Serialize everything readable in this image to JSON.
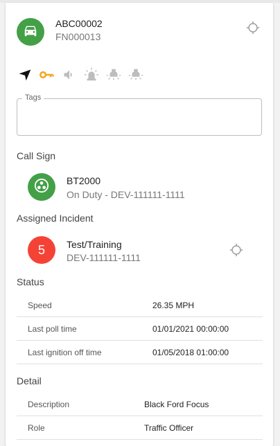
{
  "vehicle": {
    "title": "ABC00002",
    "subtitle": "FN000013",
    "avatar_icon": "car-icon",
    "avatar_color": "#43a047"
  },
  "status_icons": [
    {
      "name": "navigation-arrow-icon",
      "color": "#111111"
    },
    {
      "name": "key-icon",
      "color": "#f5a623"
    },
    {
      "name": "speaker-icon",
      "color": "#bdbdbd"
    },
    {
      "name": "siren-icon",
      "color": "#bdbdbd"
    },
    {
      "name": "light-bulb-icon",
      "color": "#bdbdbd"
    },
    {
      "name": "light-bulb-icon",
      "color": "#bdbdbd"
    }
  ],
  "tags": {
    "label": "Tags",
    "value": ""
  },
  "call_sign": {
    "section_title": "Call Sign",
    "title": "BT2000",
    "subtitle": "On Duty - DEV-111111-1111",
    "avatar_icon": "unit-icon",
    "avatar_color": "#43a047"
  },
  "assigned_incident": {
    "section_title": "Assigned Incident",
    "badge": "5",
    "badge_color": "#f44336",
    "title": "Test/Training",
    "subtitle": "DEV-111111-1111"
  },
  "status": {
    "section_title": "Status",
    "rows": [
      {
        "label": "Speed",
        "value": "26.35 MPH"
      },
      {
        "label": "Last poll time",
        "value": "01/01/2021 00:00:00"
      },
      {
        "label": "Last ignition off time",
        "value": "01/05/2018 01:00:00"
      }
    ]
  },
  "detail": {
    "section_title": "Detail",
    "rows": [
      {
        "label": "Description",
        "value": "Black Ford Focus"
      },
      {
        "label": "Role",
        "value": "Traffic Officer"
      }
    ]
  }
}
